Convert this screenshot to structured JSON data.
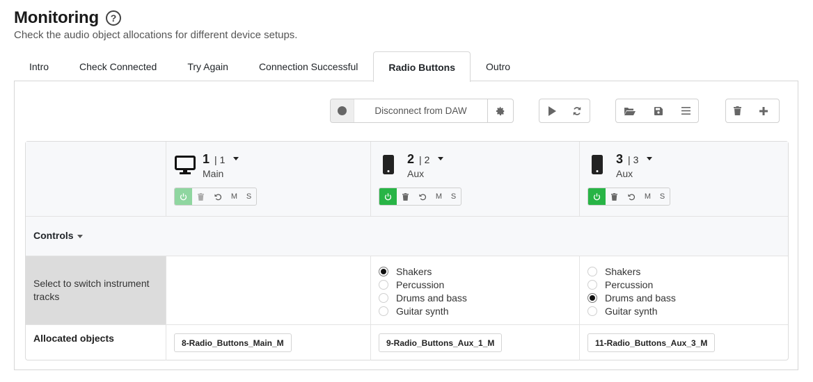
{
  "header": {
    "title": "Monitoring",
    "help_icon": "?",
    "subtitle": "Check the audio object allocations for different device setups."
  },
  "tabs": [
    {
      "label": "Intro",
      "active": false
    },
    {
      "label": "Check Connected",
      "active": false
    },
    {
      "label": "Try Again",
      "active": false
    },
    {
      "label": "Connection Successful",
      "active": false
    },
    {
      "label": "Radio Buttons",
      "active": true
    },
    {
      "label": "Outro",
      "active": false
    }
  ],
  "toolbar": {
    "record_icon": "circle-icon",
    "daw_button": "Disconnect from DAW",
    "settings_icon": "gear-icon",
    "play_icon": "play-icon",
    "refresh_icon": "refresh-icon",
    "open_icon": "folder-open-icon",
    "save_icon": "save-icon",
    "menu_icon": "list-icon",
    "delete_icon": "trash-icon",
    "add_icon": "plus-icon"
  },
  "speakers": [
    {
      "number": "1",
      "sub": "1",
      "type": "Main",
      "icon": "monitor-icon",
      "power_on": false,
      "mute": "M",
      "solo": "S"
    },
    {
      "number": "2",
      "sub": "2",
      "type": "Aux",
      "icon": "phone-icon",
      "power_on": true,
      "mute": "M",
      "solo": "S"
    },
    {
      "number": "3",
      "sub": "3",
      "type": "Aux",
      "icon": "phone-icon",
      "power_on": true,
      "mute": "M",
      "solo": "S"
    }
  ],
  "controls": {
    "label": "Controls",
    "radio_row_label": "Select to switch instrument tracks",
    "radio_options": [
      "Shakers",
      "Percussion",
      "Drums and bass",
      "Guitar synth"
    ],
    "speaker2_selected": "Shakers",
    "speaker3_selected": "Drums and bass"
  },
  "allocated": {
    "label": "Allocated objects",
    "objects": [
      "8-Radio_Buttons_Main_M",
      "9-Radio_Buttons_Aux_1_M",
      "11-Radio_Buttons_Aux_3_M"
    ]
  },
  "colors": {
    "power_on": "#28b446",
    "power_dim": "#8fd6a0"
  }
}
